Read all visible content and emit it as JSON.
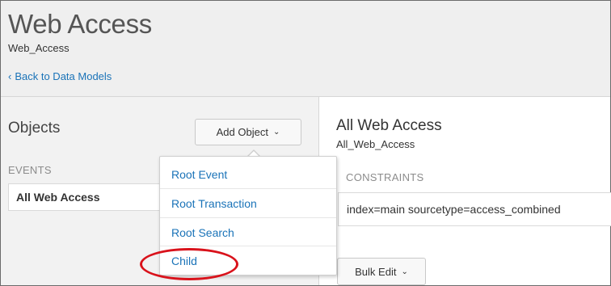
{
  "header": {
    "title": "Web Access",
    "subtitle": "Web_Access",
    "back_link": "Back to Data Models"
  },
  "left_panel": {
    "heading": "Objects",
    "add_object_label": "Add Object",
    "events_label": "EVENTS",
    "events": [
      {
        "label": "All Web Access"
      }
    ]
  },
  "dropdown": {
    "items": [
      {
        "label": "Root Event"
      },
      {
        "label": "Root Transaction"
      },
      {
        "label": "Root Search"
      },
      {
        "label": "Child"
      }
    ],
    "highlighted_item": "Child"
  },
  "right_panel": {
    "title": "All Web Access",
    "subtitle": "All_Web_Access",
    "constraints_label": "CONSTRAINTS",
    "constraint_value": "index=main sourcetype=access_combined",
    "bulk_edit_label": "Bulk Edit"
  },
  "colors": {
    "link": "#1a73b8",
    "highlight": "#d9121b",
    "panel_bg": "#f2f2f2"
  },
  "icons": {
    "back": "chevron-left-icon",
    "dropdown": "chevron-down-icon"
  }
}
